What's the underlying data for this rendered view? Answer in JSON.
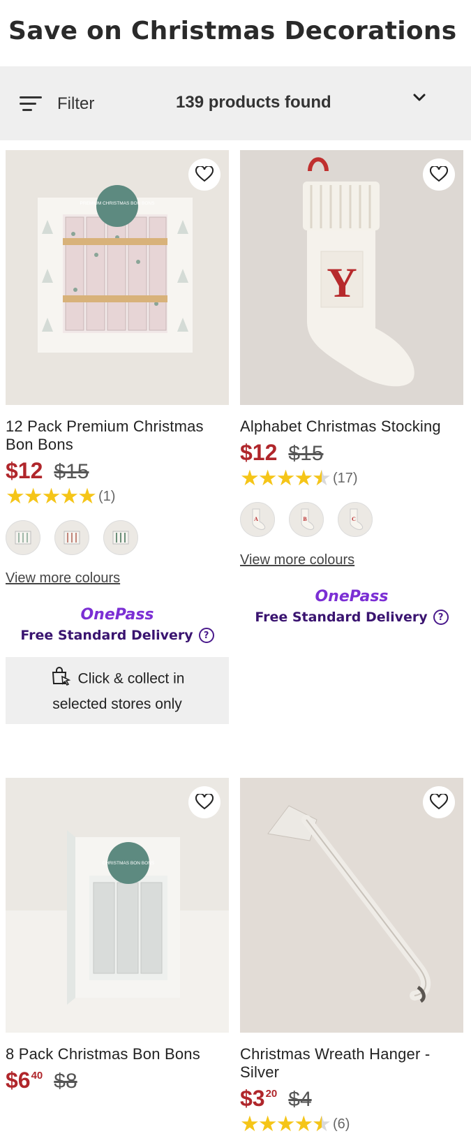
{
  "page_title": "Save on Christmas Decorations",
  "toolbar": {
    "filter_label": "Filter",
    "count_label": "139 products found"
  },
  "icons": {
    "filter": "filter-lines-icon",
    "sort": "chevron-down-icon",
    "wishlist": "heart-outline-icon",
    "help": "question-circle-icon",
    "collect": "shopping-bag-cursor-icon"
  },
  "colors": {
    "price": "#b0262b",
    "onepass": "#7b2fd4",
    "delivery": "#3a1470",
    "star": "#f5c518"
  },
  "products": [
    {
      "name": "12 Pack Premium Christmas Bon Bons",
      "price_now": "$12",
      "price_was": "$15",
      "rating": 5,
      "review_count": "(1)",
      "swatch_count": 3,
      "more_colours": "View more colours",
      "onepass_logo": "OnePass",
      "delivery_text": "Free Standard Delivery",
      "collect_line1": "Click & collect in",
      "collect_line2": "selected stores only",
      "image_text": "PREMIUM CHRISTMAS BON BONS"
    },
    {
      "name": "Alphabet Christmas Stocking",
      "price_now": "$12",
      "price_was": "$15",
      "rating": 4.5,
      "review_count": "(17)",
      "swatches": [
        "A",
        "B",
        "C"
      ],
      "more_colours": "View more colours",
      "onepass_logo": "OnePass",
      "delivery_text": "Free Standard Delivery",
      "image_text": "Y"
    },
    {
      "name": "8 Pack Christmas Bon Bons",
      "price_now_main": "$6",
      "price_now_cents": "40",
      "price_was": "$8",
      "image_text": "CHRISTMAS BON BONS"
    },
    {
      "name": "Christmas Wreath Hanger - Silver",
      "price_now_main": "$3",
      "price_now_cents": "20",
      "price_was": "$4",
      "review_count": "(6)"
    }
  ]
}
